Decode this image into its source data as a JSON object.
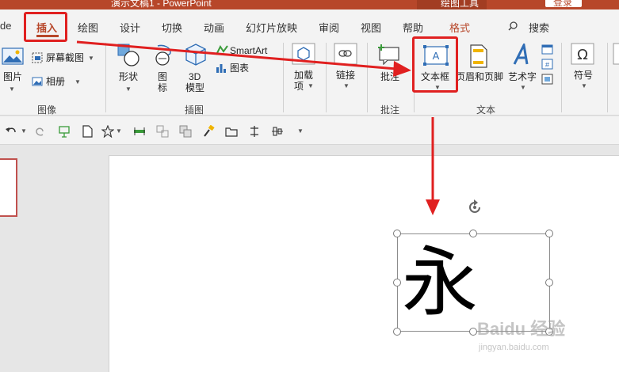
{
  "titlebar": {
    "doc_title": "演示文稿1 - PowerPoint",
    "context_tab": "绘图工具",
    "login": "登录"
  },
  "tabs": [
    {
      "label": "de"
    },
    {
      "label": "插入"
    },
    {
      "label": "绘图"
    },
    {
      "label": "设计"
    },
    {
      "label": "切换"
    },
    {
      "label": "动画"
    },
    {
      "label": "幻灯片放映"
    },
    {
      "label": "审阅"
    },
    {
      "label": "视图"
    },
    {
      "label": "帮助"
    },
    {
      "label": "格式"
    }
  ],
  "active_tab": "插入",
  "search": {
    "label": "搜索"
  },
  "ribbon": {
    "images": {
      "pictures": "图片",
      "screenshot": "屏幕截图",
      "album": "相册",
      "group_label": "图像"
    },
    "illustrations": {
      "shapes": "形状",
      "icons_line1": "图",
      "icons_line2": "标",
      "models_line1": "3D",
      "models_line2": "模型",
      "smartart": "SmartArt",
      "chart": "图表",
      "group_label": "插图"
    },
    "addins": {
      "line1": "加载",
      "line2": "项"
    },
    "links": {
      "label": "链接"
    },
    "comments": {
      "comment": "批注",
      "group_label": "批注"
    },
    "text": {
      "textbox": "文本框",
      "header_footer": "页眉和页脚",
      "wordart": "艺术字",
      "group_label": "文本"
    },
    "symbols": {
      "symbol": "符号"
    }
  },
  "slide": {
    "character": "永"
  },
  "watermark": {
    "main": "Baidu 经验",
    "sub": "jingyan.baidu.com"
  },
  "colors": {
    "accent": "#b7472a",
    "annotation": "#e02020"
  }
}
